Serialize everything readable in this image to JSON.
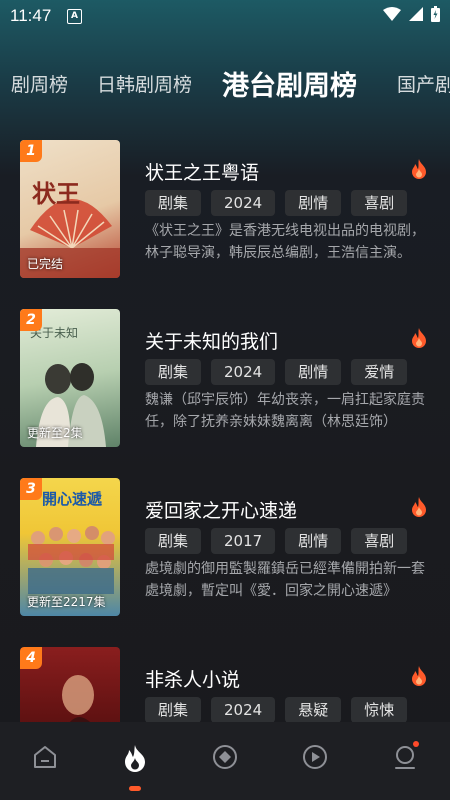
{
  "status_bar": {
    "time": "11:47",
    "a_badge": "A"
  },
  "tabs": [
    {
      "label": "剧周榜"
    },
    {
      "label": "日韩剧周榜"
    },
    {
      "label": "港台剧周榜",
      "active": true
    },
    {
      "label": "国产剧"
    }
  ],
  "items": [
    {
      "rank": "1",
      "title": "状王之王粤语",
      "status": "已完结",
      "tags": [
        "剧集",
        "2024",
        "剧情",
        "喜剧"
      ],
      "desc": "《状王之王》是香港无线电视出品的电视剧，林子聪导演，韩辰辰总编剧，王浩信主演。",
      "poster_colors": [
        "#e9d2b8",
        "#c94a36"
      ]
    },
    {
      "rank": "2",
      "title": "关于未知的我们",
      "status": "更新至2集",
      "tags": [
        "剧集",
        "2024",
        "剧情",
        "爱情"
      ],
      "desc": "魏谦（邱宇辰饰）年幼丧亲，一肩扛起家庭责任，除了抚养亲妹妹魏离离（林思廷饰）",
      "poster_colors": [
        "#cfe0c6",
        "#6a8f72"
      ]
    },
    {
      "rank": "3",
      "title": "爱回家之开心速递",
      "status": "更新至2217集",
      "tags": [
        "剧集",
        "2017",
        "剧情",
        "喜剧"
      ],
      "desc": "處境劇的御用監製羅鎮岳已經準備開拍新一套處境劇，暫定叫《愛．回家之開心速遞》",
      "poster_colors": [
        "#f2d04a",
        "#3a7a9a"
      ]
    },
    {
      "rank": "4",
      "title": "非杀人小说",
      "status": "",
      "tags": [
        "剧集",
        "2024",
        "悬疑",
        "惊悚"
      ],
      "desc": "",
      "poster_colors": [
        "#7a1c1c",
        "#2a0a0a"
      ]
    }
  ],
  "bottom_nav": [
    {
      "icon": "home-icon"
    },
    {
      "icon": "fire-icon",
      "active": true
    },
    {
      "icon": "compass-icon"
    },
    {
      "icon": "play-icon"
    },
    {
      "icon": "profile-icon",
      "has_dot": true
    }
  ],
  "colors": {
    "accent": "#ff7a1a",
    "fire": "#ff5a2a"
  }
}
